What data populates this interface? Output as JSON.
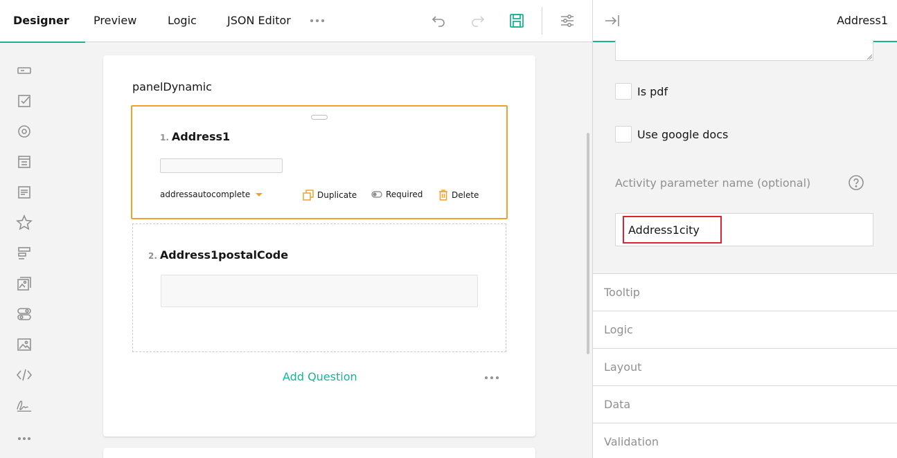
{
  "tabs": [
    {
      "label": "Designer",
      "active": true
    },
    {
      "label": "Preview",
      "active": false
    },
    {
      "label": "Logic",
      "active": false
    },
    {
      "label": "JSON Editor",
      "active": false
    }
  ],
  "toolbar": {
    "icons": [
      "undo-icon",
      "redo-icon",
      "save-icon",
      "settings-icon"
    ],
    "accent": "#19b394"
  },
  "toolbox": {
    "icons": [
      "text-icon",
      "checkbox-icon",
      "radiogroup-icon",
      "dropdown-icon",
      "comment-icon",
      "rating-icon",
      "ranking-icon",
      "imagepicker-icon",
      "boolean-icon",
      "image-icon",
      "html-icon",
      "signature-icon",
      "more-icon"
    ]
  },
  "canvas": {
    "panel_title": "panelDynamic",
    "question1": {
      "number": "1.",
      "title": "Address1",
      "type": "addressautocomplete",
      "actions": {
        "duplicate": "Duplicate",
        "required": "Required",
        "delete": "Delete"
      }
    },
    "question2": {
      "number": "2.",
      "title": "Address1postalCode"
    },
    "add_question": "Add Question"
  },
  "property_panel": {
    "title": "Address1",
    "is_pdf": "Is pdf",
    "use_google_docs": "Use google docs",
    "param_label": "Activity parameter name (optional)",
    "param_value": "Address1city",
    "sections": [
      "Tooltip",
      "Logic",
      "Layout",
      "Data",
      "Validation"
    ]
  }
}
